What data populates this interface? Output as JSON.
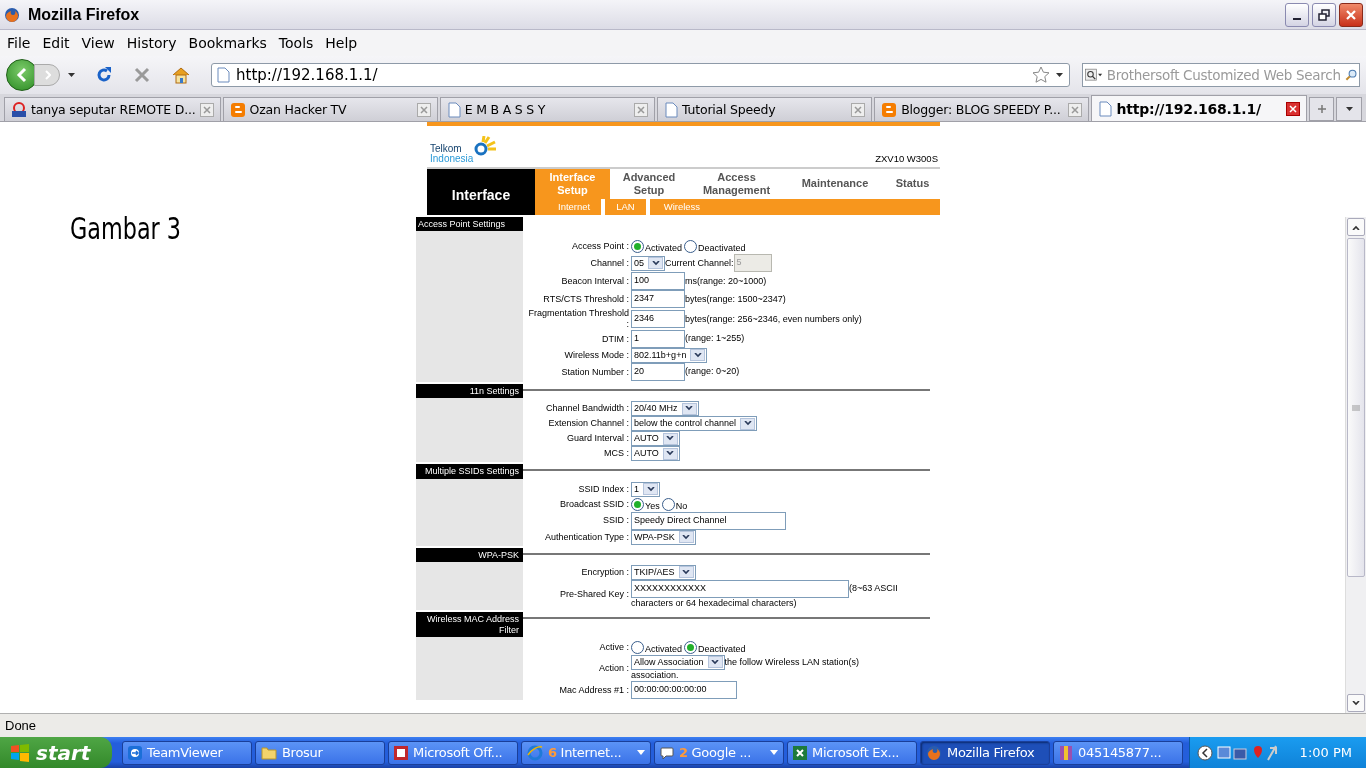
{
  "window": {
    "title": "Mozilla Firefox"
  },
  "menu": [
    "File",
    "Edit",
    "View",
    "History",
    "Bookmarks",
    "Tools",
    "Help"
  ],
  "address": {
    "value": "http://192.168.1.1/"
  },
  "search": {
    "placeholder": "Brothersoft Customized Web Search"
  },
  "tabs": [
    {
      "label": "tanya seputar REMOTE D...",
      "kind": "ws",
      "selected": false
    },
    {
      "label": "Ozan Hacker TV",
      "kind": "blogger",
      "selected": false
    },
    {
      "label": "E M B A S S Y",
      "kind": "page",
      "selected": false
    },
    {
      "label": "Tutorial Speedy",
      "kind": "page",
      "selected": false
    },
    {
      "label": "Blogger: BLOG SPEEDY P...",
      "kind": "blogger",
      "selected": false
    },
    {
      "label": "http://192.168.1.1/",
      "kind": "page",
      "selected": true
    }
  ],
  "annotation": "Gambar 3",
  "router": {
    "brand": "Telkom",
    "region": "Indonesia",
    "model": "ZXV10 W300S",
    "section_title": "Interface",
    "nav": [
      {
        "label": "Interface Setup",
        "selected": true
      },
      {
        "label": "Advanced Setup",
        "selected": false
      },
      {
        "label": "Access Management",
        "selected": false
      },
      {
        "label": "Maintenance",
        "selected": false
      },
      {
        "label": "Status",
        "selected": false
      }
    ],
    "subnav": [
      "Internet",
      "LAN",
      "Wireless"
    ],
    "sections": [
      {
        "title": "Access Point Settings",
        "rows": [
          {
            "label": "Access Point :",
            "controls": [
              {
                "kind": "radio",
                "options": [
                  {
                    "label": "Activated",
                    "selected": true
                  },
                  {
                    "label": "Deactivated",
                    "selected": false
                  }
                ]
              }
            ]
          },
          {
            "label": "Channel :",
            "controls": [
              {
                "kind": "select",
                "value": "05"
              },
              {
                "kind": "text",
                "text": "Current Channel:"
              },
              {
                "kind": "smallfield",
                "value": "5",
                "disabled": true
              }
            ]
          },
          {
            "label": "Beacon Interval :",
            "controls": [
              {
                "kind": "field",
                "value": "100",
                "disabled": false
              },
              {
                "kind": "text",
                "text": "ms(range: 20~1000)"
              }
            ]
          },
          {
            "label": "RTS/CTS Threshold :",
            "controls": [
              {
                "kind": "field",
                "value": "2347",
                "disabled": false
              },
              {
                "kind": "text",
                "text": "bytes(range: 1500~2347)"
              }
            ]
          },
          {
            "label": "Fragmentation Threshold :",
            "controls": [
              {
                "kind": "field",
                "value": "2346",
                "disabled": false
              },
              {
                "kind": "text",
                "text": "bytes(range: 256~2346, even numbers only)"
              }
            ]
          },
          {
            "label": "DTIM :",
            "controls": [
              {
                "kind": "field",
                "value": "1",
                "disabled": false
              },
              {
                "kind": "text",
                "text": "(range: 1~255)"
              }
            ]
          },
          {
            "label": "Wireless Mode :",
            "controls": [
              {
                "kind": "select",
                "value": "802.11b+g+n"
              }
            ]
          },
          {
            "label": "Station Number :",
            "controls": [
              {
                "kind": "field",
                "value": "20",
                "disabled": false
              },
              {
                "kind": "text",
                "text": "(range: 0~20)"
              }
            ]
          }
        ]
      },
      {
        "title": "11n Settings",
        "rows": [
          {
            "label": "Channel Bandwidth :",
            "controls": [
              {
                "kind": "select",
                "value": "20/40 MHz"
              }
            ]
          },
          {
            "label": "Extension Channel :",
            "controls": [
              {
                "kind": "select",
                "value": "below the control channel"
              }
            ]
          },
          {
            "label": "Guard Interval :",
            "controls": [
              {
                "kind": "select",
                "value": "AUTO"
              }
            ]
          },
          {
            "label": "MCS :",
            "controls": [
              {
                "kind": "select",
                "value": "AUTO"
              }
            ]
          }
        ]
      },
      {
        "title": "Multiple SSIDs Settings",
        "rows": [
          {
            "label": "SSID Index :",
            "controls": [
              {
                "kind": "select",
                "value": "1"
              }
            ]
          },
          {
            "label": "Broadcast SSID :",
            "controls": [
              {
                "kind": "radio",
                "options": [
                  {
                    "label": "Yes",
                    "selected": true
                  },
                  {
                    "label": "No",
                    "selected": false
                  }
                ]
              }
            ]
          },
          {
            "label": "SSID :",
            "controls": [
              {
                "kind": "namefield",
                "value": "Speedy Direct Channel",
                "disabled": false
              }
            ]
          },
          {
            "label": "Authentication Type :",
            "controls": [
              {
                "kind": "select",
                "value": "WPA-PSK"
              }
            ]
          }
        ]
      },
      {
        "title": "WPA-PSK",
        "rows": [
          {
            "label": "Encryption :",
            "controls": [
              {
                "kind": "select",
                "value": "TKIP/AES"
              }
            ]
          },
          {
            "label": "Pre-Shared Key :",
            "controls": [
              {
                "kind": "keyfield",
                "value": "XXXXXXXXXXXX",
                "disabled": false
              },
              {
                "kind": "text",
                "text": "(8~63 ASCII"
              },
              {
                "kind": "linetext",
                "text": "characters or 64 hexadecimal characters)"
              }
            ]
          }
        ]
      },
      {
        "title": "Wireless MAC Address Filter",
        "rows": [
          {
            "label": "Active :",
            "controls": [
              {
                "kind": "radio",
                "options": [
                  {
                    "label": "Activated",
                    "selected": false
                  },
                  {
                    "label": "Deactivated",
                    "selected": true
                  }
                ]
              }
            ]
          },
          {
            "label": "Action :",
            "controls": [
              {
                "kind": "select",
                "value": "Allow Association"
              },
              {
                "kind": "text",
                "text": "the follow Wireless LAN station(s)"
              },
              {
                "kind": "linetext",
                "text": "association."
              }
            ]
          },
          {
            "label": "Mac Address #1 :",
            "controls": [
              {
                "kind": "addressfield",
                "value": "00:00:00:00:00:00",
                "disabled": false
              }
            ]
          }
        ]
      }
    ]
  },
  "status_bar": "Done",
  "taskbar": {
    "start": "start",
    "clock": "1:00 PM",
    "items": [
      {
        "label": "TeamViewer",
        "kind": "teamviewer",
        "grouped": false,
        "selected": false
      },
      {
        "label": "Brosur",
        "kind": "folder",
        "grouped": false,
        "selected": false
      },
      {
        "label": "Microsoft Off...",
        "kind": "office",
        "grouped": false,
        "selected": false
      },
      {
        "label": "Internet...",
        "count": "6",
        "kind": "ie",
        "grouped": true,
        "selected": false
      },
      {
        "label": "Google ...",
        "count": "2",
        "kind": "chat",
        "grouped": true,
        "selected": false
      },
      {
        "label": "Microsoft Ex...",
        "kind": "excel",
        "grouped": false,
        "selected": false
      },
      {
        "label": "Mozilla Firefox",
        "kind": "firefox",
        "grouped": false,
        "selected": true
      },
      {
        "label": "045145877...",
        "kind": "archive",
        "grouped": false,
        "selected": false
      }
    ]
  }
}
